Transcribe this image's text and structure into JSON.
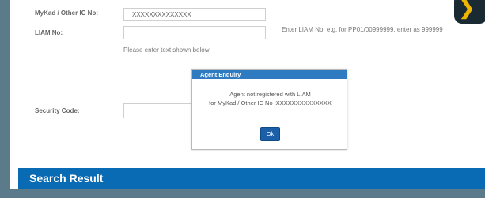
{
  "form": {
    "mykad_label": "MyKad / Other IC No:",
    "mykad_value": "XXXXXXXXXXXXXX",
    "liam_label": "LIAM No:",
    "liam_value": "",
    "liam_hint": "Enter LIAM No. e.g. for PP01/00999999, enter as 999999",
    "security_instruction": "Please enter text shown below:",
    "security_label": "Security Code:",
    "security_value": ""
  },
  "dialog": {
    "title": "Agent Enquiry",
    "message_line1": "Agent not registered with LIAM",
    "message_line2": "for MyKad / Other IC No :XXXXXXXXXXXXXX",
    "ok_label": "Ok"
  },
  "results": {
    "title": "Search Result"
  },
  "icons": {
    "corner_badge": "chevron-right-icon"
  },
  "colors": {
    "dialog_header": "#2e7bc1",
    "ok_button": "#1a5fa8",
    "result_bar": "#0a6bb5",
    "corner_chevron": "#f0b500"
  }
}
